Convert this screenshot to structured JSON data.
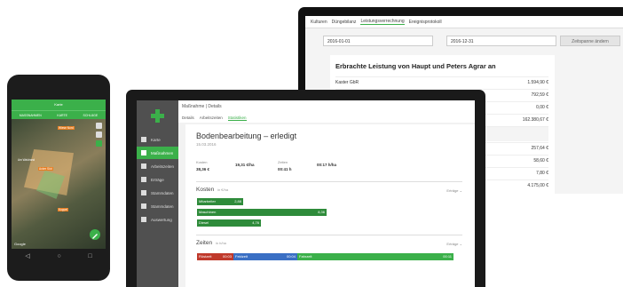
{
  "monitor": {
    "tabs": [
      "Kulturen",
      "Düngebilanz",
      "Leistungsverrechnung",
      "Ereignisprotokoll"
    ],
    "filter_from": "2016-01-01",
    "filter_to": "2016-12-31",
    "apply_button": "Zeitspanne ändern",
    "card_title": "Erbrachte Leistung von Haupt und Peters Agrar an",
    "rows": [
      {
        "label": "Kaster GbR",
        "value": "1.594,90 €"
      },
      {
        "label": "",
        "value": "792,59 €"
      },
      {
        "label": "",
        "value": "0,00 €"
      },
      {
        "label": "",
        "value": "162.380,67 €"
      },
      {
        "label": "",
        "value": ""
      },
      {
        "label": "",
        "value": "257,64 €"
      },
      {
        "label": "",
        "value": "58,60 €"
      },
      {
        "label": "",
        "value": "7,80 €"
      },
      {
        "label": "",
        "value": "4.175,00 €"
      }
    ]
  },
  "laptop": {
    "breadcrumb": "Maßnahme | Details",
    "subtabs": [
      "Details",
      "Arbeitszeiten",
      "Statistiken"
    ],
    "nav": [
      {
        "label": "Karte",
        "icon": "map-icon"
      },
      {
        "label": "Maßnahmen",
        "icon": "list-icon"
      },
      {
        "label": "Arbeitszeiten",
        "icon": "calendar-icon"
      },
      {
        "label": "Erträge",
        "icon": "harvest-icon"
      },
      {
        "label": "Stammdaten",
        "icon": "document-icon"
      },
      {
        "label": "Stammdaten",
        "icon": "database-icon"
      },
      {
        "label": "Auswertung",
        "icon": "chart-icon"
      }
    ],
    "title": "Bodenbearbeitung – erledigt",
    "date": "15.03.2016",
    "metrics": [
      {
        "label": "Kosten",
        "value": "38,36 €"
      },
      {
        "label": "",
        "value": "19,31 €/ha"
      },
      {
        "label": "Zeiten",
        "value": "00:41 h"
      },
      {
        "label": "",
        "value": "00:17 h/ha"
      }
    ],
    "costs_title": "Kosten",
    "costs_unit": "in €/ha",
    "costs_link": "Erträge",
    "cost_bars": [
      {
        "label": "Mitarbeiter",
        "value": "2,88",
        "fraction": 0.35
      },
      {
        "label": "Maschinen",
        "value": "8,36",
        "fraction": 1.0
      },
      {
        "label": "Diesel",
        "value": "4,76",
        "fraction": 0.49
      }
    ],
    "times_title": "Zeiten",
    "times_unit": "in h/ha",
    "times_link": "Erträge",
    "time_segments": [
      {
        "label": "Rüstzeit",
        "value": "00:03",
        "fraction": 0.14,
        "color": "#c0392b"
      },
      {
        "label": "Feldzeit",
        "value": "00:04",
        "fraction": 0.25,
        "color": "#3a6fc4"
      },
      {
        "label": "Fahrzeit",
        "value": "00:11",
        "fraction": 0.61,
        "color": "#3bb04a"
      }
    ]
  },
  "phone": {
    "title": "Karte",
    "tabs": [
      "MASSNAHMEN",
      "KARTE",
      "SCHLÄGE"
    ],
    "labels": [
      "Wiese Nord",
      "Acker Süd",
      "Koppel",
      "Am Waldrand"
    ],
    "attribution": "Google"
  },
  "colors": {
    "accent": "#3bb04a",
    "dark_green": "#2e8b3a"
  }
}
